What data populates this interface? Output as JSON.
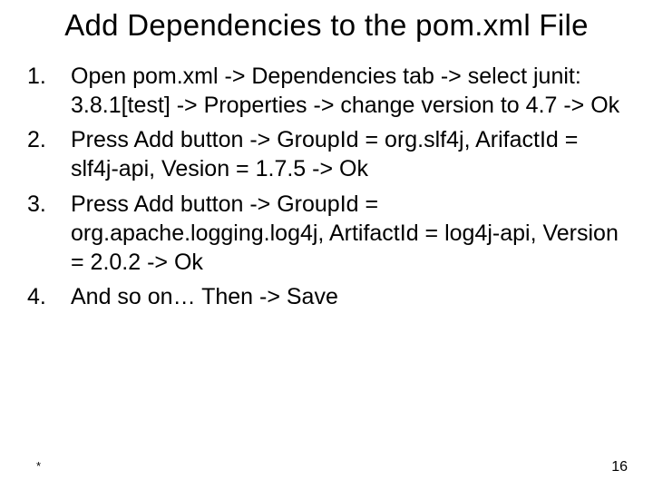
{
  "title": "Add Dependencies to the pom.xml File",
  "items": [
    "Open pom.xml -> Dependencies tab -> select junit: 3.8.1[test] -> Properties -> change version to 4.7 -> Ok",
    "Press Add button -> GroupId = org.slf4j, ArifactId = slf4j-api, Vesion = 1.7.5 -> Ok",
    "Press Add button -> GroupId = org.apache.logging.log4j, ArtifactId = log4j-api, Version = 2.0.2 -> Ok",
    "And so on… Then -> Save"
  ],
  "footer": {
    "left": "*",
    "right": "16"
  }
}
